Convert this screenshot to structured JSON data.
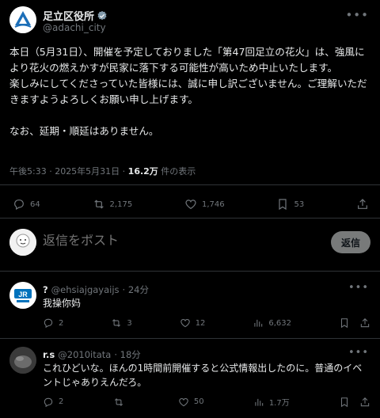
{
  "post": {
    "author_name": "足立区役所",
    "author_handle": "@adachi_city",
    "body": "本日（5月31日）、開催を予定しておりました「第47回足立の花火」は、強風により花火の燃えかすが民家に落下する可能性が高いため中止いたします。\n楽しみにしてくださっていた皆様には、誠に申し訳ございません。ご理解いただきますようよろしくお願い申し上げます。\n\nなお、延期・順延はありません。",
    "time": "午後5:33 · 2025年5月31日 · ",
    "views": "16.2万",
    "views_suffix": " 件の表示",
    "stats": {
      "replies": "64",
      "reposts": "2,175",
      "likes": "1,746",
      "bookmarks": "53"
    }
  },
  "composer": {
    "placeholder": "返信をポスト",
    "button": "返信"
  },
  "replies": [
    {
      "name": "?",
      "handle": "@ehsiajgayaijs",
      "time": "· 24分",
      "text": "我操你妈",
      "avatar_text": "JR",
      "stats": {
        "replies": "2",
        "reposts": "3",
        "likes": "12",
        "views": "6,632"
      }
    },
    {
      "name": "r.s",
      "handle": "@2010itata",
      "time": "· 18分",
      "text": "これひどいな。ほんの1時間前開催すると公式情報出したのに。普通のイベントじゃありえんだろ。",
      "stats": {
        "replies": "2",
        "reposts": "",
        "likes": "50",
        "views": "1.7万"
      }
    }
  ],
  "colors": {
    "verified": "#829aab",
    "logo": "#1d6fb8",
    "jr_blue": "#0072bc"
  }
}
